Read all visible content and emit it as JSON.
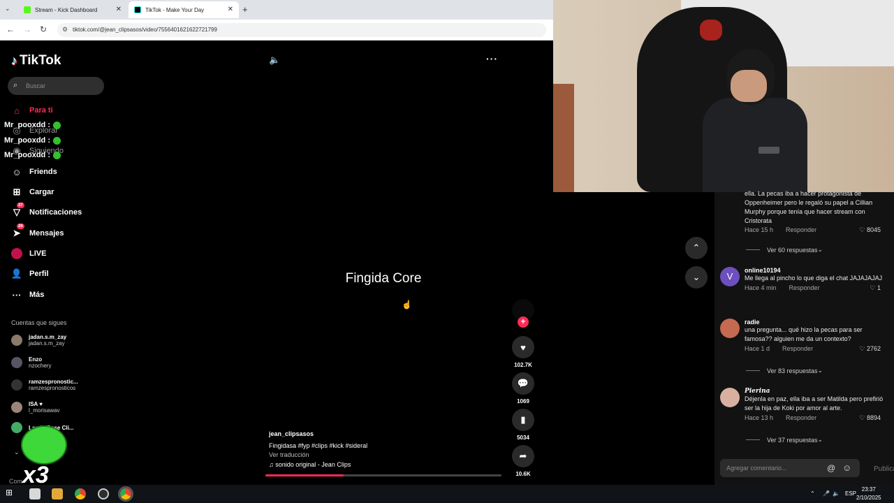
{
  "browser": {
    "tabs": [
      {
        "label": "Stream - Kick Dashboard",
        "favicon_color": "#53fc18"
      },
      {
        "label": "TikTok - Make Your Day",
        "favicon_color": "#000000"
      }
    ],
    "url": "tiktok.com/@jean_clipsasos/video/7556401621622721799"
  },
  "tiktok": {
    "logo_text": "TikTok",
    "search_placeholder": "Buscar",
    "nav": [
      {
        "label": "Para ti",
        "icon": "home-icon"
      },
      {
        "label": "Explorar",
        "icon": "compass-icon"
      },
      {
        "label": "Siguiendo",
        "icon": "following-icon"
      },
      {
        "label": "Friends",
        "icon": "friends-icon"
      },
      {
        "label": "Cargar",
        "icon": "upload-icon"
      },
      {
        "label": "Notificaciones",
        "icon": "inbox-icon",
        "badge": "37"
      },
      {
        "label": "Mensajes",
        "icon": "messages-icon",
        "badge": "26"
      },
      {
        "label": "LIVE",
        "icon": "live-icon"
      },
      {
        "label": "Perfil",
        "icon": "profile-icon"
      },
      {
        "label": "Más",
        "icon": "more-icon"
      }
    ],
    "following_title": "Cuentas que sigues",
    "following": [
      {
        "name": "jadan.s.m_zay",
        "handle": "jadan.s.m_zay"
      },
      {
        "name": "Enzo",
        "handle": "nzochery"
      },
      {
        "name": "ramzespronostic...",
        "handle": "ramzespronosticos"
      },
      {
        "name": "ISA ♥",
        "handle": "l_morisawav"
      },
      {
        "name": "Lauda Rose Cli...",
        "handle": ""
      }
    ],
    "more_truncated": "Com",
    "video": {
      "title": "Fingida Core",
      "username": "jean_clipsasos",
      "caption": "Fingidasa #fyp  #clips  #kick  #sideral",
      "translate": "Ver traducción",
      "sound": "sonido original - Jean Clips",
      "progress": 0.33
    },
    "actions": [
      {
        "icon": "heart-icon",
        "count": "102.7K"
      },
      {
        "icon": "comment-icon",
        "count": "1069"
      },
      {
        "icon": "bookmark-icon",
        "count": "5034"
      },
      {
        "icon": "share-icon",
        "count": "10.6K"
      }
    ]
  },
  "overlay_chat": {
    "lines": [
      "Mr_pooxdd :",
      "Mr_pooxdd :",
      "Mr_pooxdd :"
    ],
    "sticker_text": "x3"
  },
  "comments": {
    "partial": {
      "text": "ella. La pecas iba a hacer protagonista de Oppenheimer pero le regaló su papel a Cillian Murphy porque tenía que hacer stream con Cristorata",
      "time": "Hace 15 h",
      "reply": "Responder",
      "likes": "8045",
      "replies": "Ver 60 respuestas"
    },
    "items": [
      {
        "avatar_letter": "V",
        "user": "online10194",
        "text": "Me llega al pincho lo que diga el chat JAJAJAJAJ",
        "time": "Hace 4 min",
        "reply": "Responder",
        "likes": "1",
        "replies": ""
      },
      {
        "avatar_letter": "",
        "user": "radie",
        "text": "una pregunta... qué hizo la pecas para ser famosa?? alguien me da un contexto?",
        "time": "Hace 1 d",
        "reply": "Responder",
        "likes": "2762",
        "replies": "Ver 83 respuestas"
      },
      {
        "avatar_letter": "",
        "user": "Pierina",
        "text": "Déjenla en paz, ella iba a ser Matilda pero prefirió ser la hija de Koki por amor al arte.",
        "time": "Hace 13 h",
        "reply": "Responder",
        "likes": "8894",
        "replies": "Ver 37 respuestas"
      }
    ],
    "input_placeholder": "Agregar comentario...",
    "publish_label": "Publicar"
  },
  "taskbar": {
    "lang": "ESP",
    "time": "23:37",
    "date": "2/10/2025"
  },
  "colors": {
    "accent": "#fe2c55",
    "kick_green": "#53fc18"
  }
}
